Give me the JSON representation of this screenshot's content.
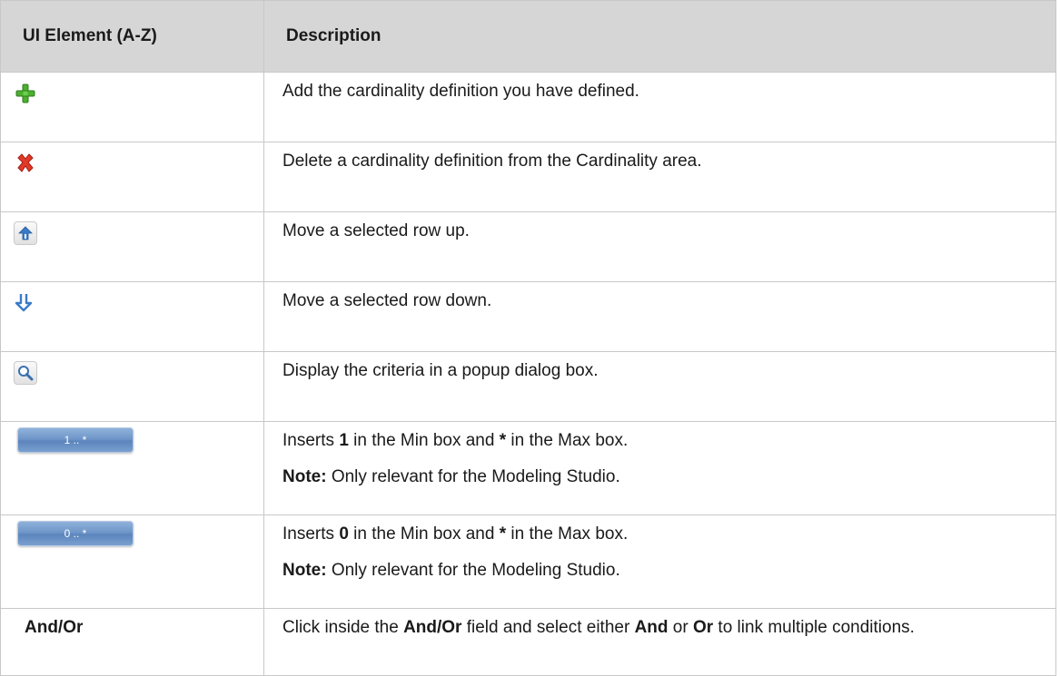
{
  "table": {
    "header_col1": "UI Element (A-Z)",
    "header_col2": "Description"
  },
  "rows": {
    "add": {
      "icon": "green-plus-icon",
      "description": "Add the cardinality definition you have defined."
    },
    "delete": {
      "icon": "red-x-delete-icon",
      "description": "Delete a cardinality definition from the Cardinality area."
    },
    "up": {
      "icon": "arrow-up-icon",
      "description": "Move a selected row up."
    },
    "down": {
      "icon": "arrow-down-icon",
      "description": "Move a selected row down."
    },
    "popup": {
      "icon": "magnifier-icon",
      "description": "Display the criteria in a popup dialog box."
    },
    "one_many": {
      "button_label": "1 .. *",
      "line1": {
        "before": "Inserts ",
        "bold1": "1",
        "middle": " in the Min box and ",
        "bold2": "*",
        "after": " in the Max box."
      },
      "note": {
        "label": "Note:",
        "text": " Only relevant for the Modeling Studio."
      }
    },
    "zero_many": {
      "button_label": "0 .. *",
      "line1": {
        "before": "Inserts ",
        "bold1": "0",
        "middle": " in the Min box and ",
        "bold2": "*",
        "after": " in the Max box."
      },
      "note": {
        "label": "Note:",
        "text": " Only relevant for the Modeling Studio."
      }
    },
    "and_or": {
      "element": "And/Or",
      "d1": "Click inside the ",
      "d2": "And/Or",
      "d3": " field and select either ",
      "d4": "And",
      "d5": " or ",
      "d6": "Or",
      "d7": " to link multiple conditions."
    }
  },
  "colors": {
    "header_bg": "#d6d6d6",
    "border": "#c8c8c8",
    "plus_green": "#4caf30",
    "delete_red": "#e03a2a",
    "arrow_blue": "#3a7bc8",
    "button_blue": "#6f96c9"
  }
}
